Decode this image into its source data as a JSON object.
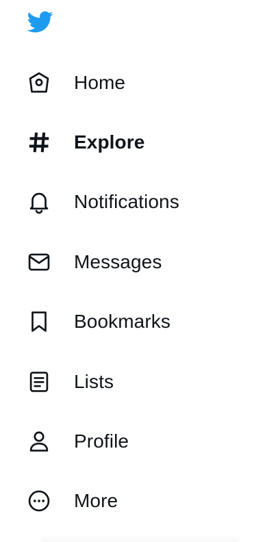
{
  "app": {
    "logo_icon": "twitter-bird-icon",
    "brand_color": "#1d9bf0",
    "text_color": "#0f1419"
  },
  "nav": {
    "items": [
      {
        "label": "Home",
        "icon": "home-icon",
        "active": false
      },
      {
        "label": "Explore",
        "icon": "hashtag-icon",
        "active": true
      },
      {
        "label": "Notifications",
        "icon": "bell-icon",
        "active": false
      },
      {
        "label": "Messages",
        "icon": "envelope-icon",
        "active": false
      },
      {
        "label": "Bookmarks",
        "icon": "bookmark-icon",
        "active": false
      },
      {
        "label": "Lists",
        "icon": "list-icon",
        "active": false
      },
      {
        "label": "Profile",
        "icon": "person-icon",
        "active": false
      },
      {
        "label": "More",
        "icon": "more-circle-icon",
        "active": false
      }
    ]
  }
}
